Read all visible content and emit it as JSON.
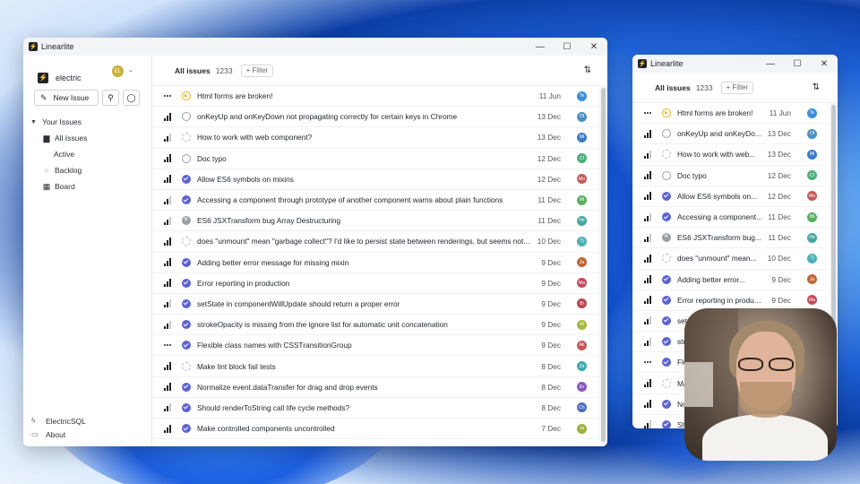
{
  "app": {
    "title": "Linearlite"
  },
  "window_controls": {
    "minimize": "—",
    "maximize": "☐",
    "close": "✕"
  },
  "sidebar": {
    "workspace": "electric",
    "avatar_initials": "EL",
    "new_issue_label": "New Issue",
    "section_label": "Your Issues",
    "items": [
      {
        "label": "All Issues",
        "icon": "inbox-icon"
      },
      {
        "label": "Active",
        "icon": "none"
      },
      {
        "label": "Backlog",
        "icon": "circle-icon"
      },
      {
        "label": "Board",
        "icon": "grid-icon"
      }
    ],
    "footer": [
      {
        "label": "ElectricSQL",
        "icon": "electric-icon"
      },
      {
        "label": "About",
        "icon": "info-icon"
      }
    ]
  },
  "header": {
    "title": "All issues",
    "count": "1233",
    "filter_label": "+ Filter"
  },
  "issues": [
    {
      "priority": "none",
      "status": "progress",
      "title": "Html forms are broken!",
      "short_title": "Html forms are broken!",
      "date": "11 Jun",
      "avatar": "Te",
      "color": "#3b8fd6"
    },
    {
      "priority": "high",
      "status": "todo",
      "title": "onKeyUp and onKeyDown not propagating correctly for certain keys in Chrome",
      "short_title": "onKeyUp and onKeyDo...",
      "date": "13 Dec",
      "avatar": "Of",
      "color": "#4a90c4"
    },
    {
      "priority": "medium",
      "status": "backlog",
      "title": "How to work with web component?",
      "short_title": "How to work with web...",
      "date": "13 Dec",
      "avatar": "Mi",
      "color": "#3a7bc8"
    },
    {
      "priority": "high",
      "status": "todo",
      "title": "Doc typo",
      "short_title": "Doc typo",
      "date": "12 Dec",
      "avatar": "Cf",
      "color": "#4bb07a"
    },
    {
      "priority": "high",
      "status": "done",
      "title": "Allow ES6 symbols on mixins",
      "short_title": "Allow ES6 symbols on...",
      "date": "12 Dec",
      "avatar": "Mo",
      "color": "#c25a5a"
    },
    {
      "priority": "medium",
      "status": "done",
      "title": "Accessing a component through prototype of another component warns about plain functions",
      "short_title": "Accessing a component...",
      "date": "11 Dec",
      "avatar": "Mi",
      "color": "#58b05c"
    },
    {
      "priority": "medium",
      "status": "cancel",
      "title": "ES6 JSXTransform bug Array Destructuring",
      "short_title": "ES6 JSXTransform bug...",
      "date": "11 Dec",
      "avatar": "He",
      "color": "#46a7a0"
    },
    {
      "priority": "high",
      "status": "backlog",
      "title": "does \"unmount\" mean \"garbage collect\"? I'd like to persist state between renderings, but seems not...",
      "short_title": "does \"unmount\" mean...",
      "date": "10 Dec",
      "avatar": "Tj",
      "color": "#4bb0b8"
    },
    {
      "priority": "high",
      "status": "done",
      "title": "Adding better error message for missing mixin",
      "short_title": "Adding better error...",
      "date": "9 Dec",
      "avatar": "Ja",
      "color": "#c2663c"
    },
    {
      "priority": "high",
      "status": "done",
      "title": "Error reporting in production",
      "short_title": "Error reporting in production",
      "date": "9 Dec",
      "avatar": "Ma",
      "color": "#c24a5a"
    },
    {
      "priority": "medium",
      "status": "done",
      "title": "setState in componentWillUpdate should return a proper error",
      "short_title": "setState in component...",
      "date": "9 Dec",
      "avatar": "Bi",
      "color": "#b8484e"
    },
    {
      "priority": "medium",
      "status": "done",
      "title": "strokeOpacity is missing from the ignore list for automatic unit concatenation",
      "short_title": "strokeOpacity is missing...",
      "date": "9 Dec",
      "avatar": "Al",
      "color": "#a6b83c"
    },
    {
      "priority": "none",
      "status": "done",
      "title": "Flexible class names with CSSTransitionGroup",
      "short_title": "Flexible class names...",
      "date": "9 Dec",
      "avatar": "Ak",
      "color": "#c25858"
    },
    {
      "priority": "high",
      "status": "backlog",
      "title": "Make lint block fail tests",
      "short_title": "Make lint block fail...",
      "date": "8 Dec",
      "avatar": "Ze",
      "color": "#3fa9b0"
    },
    {
      "priority": "high",
      "status": "done",
      "title": "Normalize event.dataTransfer for drag and drop events",
      "short_title": "Normalize event...",
      "date": "8 Dec",
      "avatar": "Er",
      "color": "#8a58c2"
    },
    {
      "priority": "medium",
      "status": "done",
      "title": "Should renderToString call life cycle methods?",
      "short_title": "Should renderToString...",
      "date": "8 Dec",
      "avatar": "Ch",
      "color": "#4a6fc2"
    },
    {
      "priority": "high",
      "status": "done",
      "title": "Make controlled components uncontrolled",
      "short_title": "Make controlled...",
      "date": "7 Dec",
      "avatar": "Ja",
      "color": "#9cb03a"
    }
  ]
}
